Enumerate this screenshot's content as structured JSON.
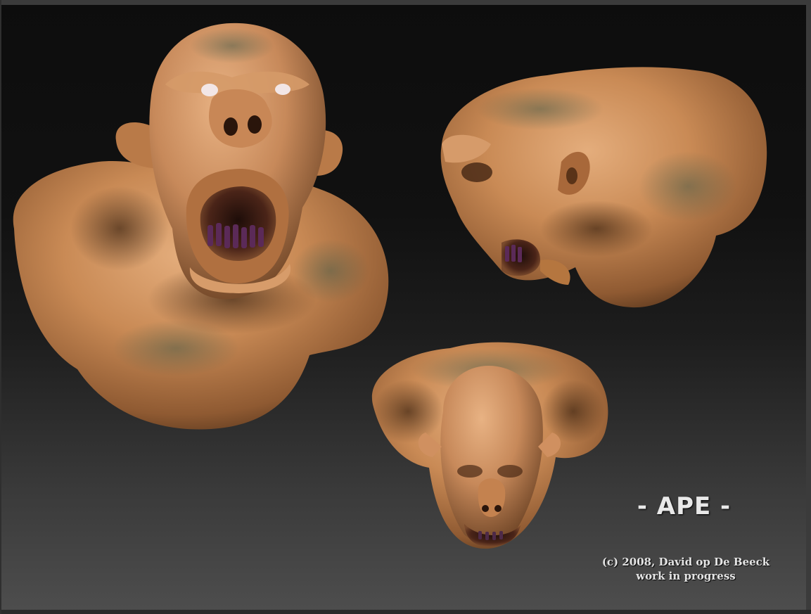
{
  "artwork": {
    "title": "- APE -",
    "credit_line": "(c) 2008, David op De Beeck",
    "status_line": "work in progress"
  },
  "views": [
    {
      "name": "front-three-quarter-view",
      "description": "open mouth front view"
    },
    {
      "name": "side-view",
      "description": "profile view"
    },
    {
      "name": "top-front-view",
      "description": "looking down front view"
    }
  ],
  "colors": {
    "skin": "#c98a55",
    "skin_light": "#e0a877",
    "skin_shadow": "#7a4a28",
    "mottle": "#5a6a55",
    "mouth": "#3a1a14",
    "teeth": "#5a2a55",
    "background_top": "#0d0d0d",
    "background_bottom": "#4e4e4e",
    "title_text": "#e9e9e9"
  }
}
